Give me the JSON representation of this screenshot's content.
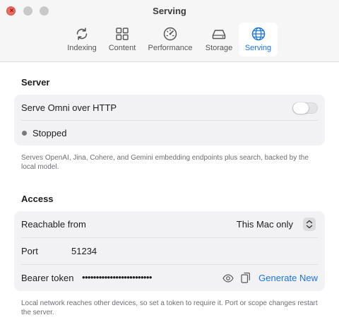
{
  "window": {
    "title": "Serving",
    "close_glyph": "×"
  },
  "tabs": [
    {
      "label": "Indexing",
      "icon": "refresh-icon",
      "active": false
    },
    {
      "label": "Content",
      "icon": "grid-icon",
      "active": false
    },
    {
      "label": "Performance",
      "icon": "gauge-icon",
      "active": false
    },
    {
      "label": "Storage",
      "icon": "drive-icon",
      "active": false
    },
    {
      "label": "Serving",
      "icon": "globe-icon",
      "active": true
    }
  ],
  "server": {
    "section_title": "Server",
    "serve_label": "Serve Omni over HTTP",
    "serve_enabled": false,
    "status_text": "Stopped",
    "status_color": "#7a7a7a",
    "caption": "Serves OpenAI, Jina, Cohere, and Gemini embedding endpoints plus search, backed by the local model."
  },
  "access": {
    "section_title": "Access",
    "reachable_label": "Reachable from",
    "reachable_value": "This Mac only",
    "port_label": "Port",
    "port_value": "51234",
    "token_label": "Bearer token",
    "token_masked": "•••••••••••••••••••••••••",
    "generate_label": "Generate New",
    "caption": "Local network reaches other devices, so set a token to require it. Port or scope changes restart the server."
  },
  "colors": {
    "accent": "#1a73e8",
    "close": "#ec6a5e"
  }
}
